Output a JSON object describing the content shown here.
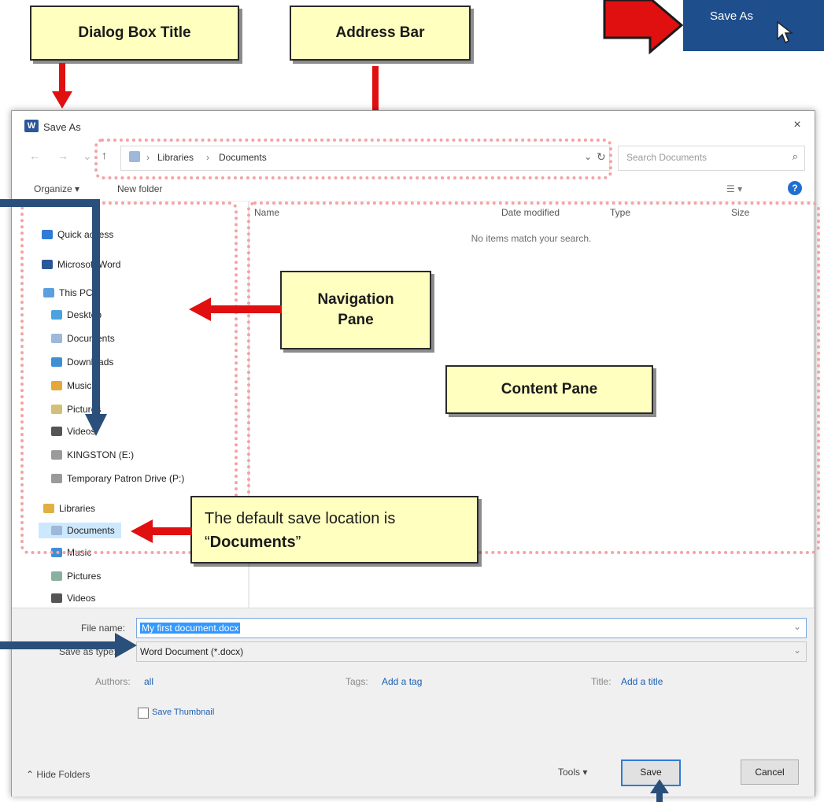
{
  "callouts": {
    "dialog_box_title": "Dialog Box Title",
    "address_bar": "Address Bar",
    "navigation_pane_line1": "Navigation",
    "navigation_pane_line2": "Pane",
    "content_pane": "Content Pane",
    "default_location_pre": "The default save location is “",
    "default_location_bold": "Documents",
    "default_location_post": "”"
  },
  "ribbon_chip": {
    "label": "Save As"
  },
  "dialog": {
    "title": "Save As",
    "close": "×",
    "address": {
      "crumbs": [
        "Libraries",
        "Documents"
      ],
      "separator": "›"
    },
    "search_placeholder": "Search Documents",
    "toolbar": {
      "organize": "Organize ▾",
      "new_folder": "New folder"
    },
    "nav_items": [
      {
        "label": "Quick access",
        "icon": "star-icon",
        "color": "#2f7bd6"
      },
      {
        "label": "Microsoft Word",
        "icon": "word-icon",
        "color": "#2b579a"
      },
      {
        "label": "This PC",
        "icon": "computer-icon",
        "color": "#5aa0e0"
      },
      {
        "label": "Desktop",
        "icon": "desktop-folder-icon",
        "color": "#4aa3df"
      },
      {
        "label": "Documents",
        "icon": "documents-folder-icon",
        "color": "#9db8d8"
      },
      {
        "label": "Downloads",
        "icon": "downloads-folder-icon",
        "color": "#3f8fd6"
      },
      {
        "label": "Music",
        "icon": "music-folder-icon",
        "color": "#e5a73a"
      },
      {
        "label": "Pictures",
        "icon": "pictures-folder-icon",
        "color": "#d2c07a"
      },
      {
        "label": "Videos",
        "icon": "videos-folder-icon",
        "color": "#555555"
      },
      {
        "label": "KINGSTON (E:)",
        "icon": "drive-icon",
        "color": "#9a9a9a"
      },
      {
        "label": "Temporary Patron Drive (P:)",
        "icon": "drive-icon",
        "color": "#9a9a9a"
      },
      {
        "label": "Libraries",
        "icon": "libraries-icon",
        "color": "#e0b040"
      },
      {
        "label": "Documents",
        "icon": "documents-library-icon",
        "color": "#9db8d8"
      },
      {
        "label": "Music",
        "icon": "music-library-icon",
        "color": "#3f8fd6"
      },
      {
        "label": "Pictures",
        "icon": "pictures-library-icon",
        "color": "#8ab0a0"
      },
      {
        "label": "Videos",
        "icon": "videos-library-icon",
        "color": "#555555"
      }
    ],
    "columns": [
      "Name",
      "Date modified",
      "Type",
      "Size"
    ],
    "empty_message": "No items match your search.",
    "file_name_label": "File name:",
    "file_name_value": "My first document.docx",
    "save_as_type_label": "Save as type:",
    "save_as_type_value": "Word Document (*.docx)",
    "authors_label": "Authors:",
    "authors_value": "all",
    "tags_label": "Tags:",
    "tags_value": "Add a tag",
    "title_label": "Title:",
    "title_value": "Add a title",
    "thumbnail_label": "Save Thumbnail",
    "hide_folders": "Hide Folders",
    "tools": "Tools ▾",
    "save_button": "Save",
    "cancel_button": "Cancel"
  }
}
